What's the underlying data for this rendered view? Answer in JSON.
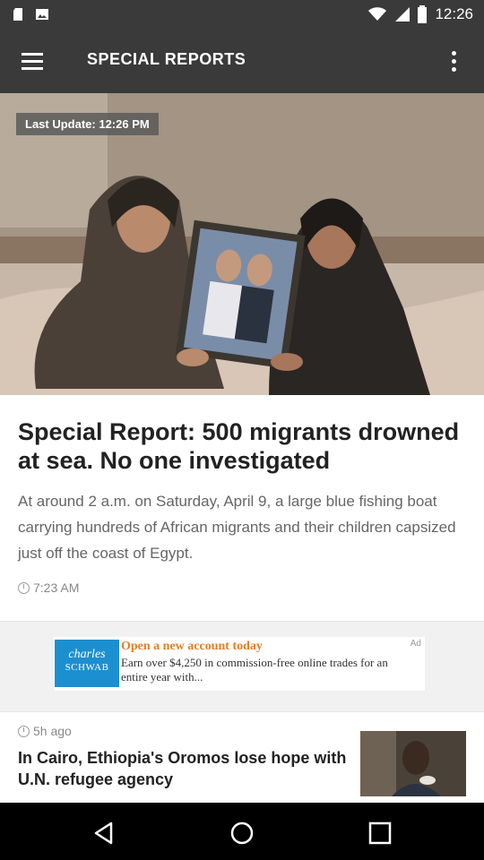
{
  "status_bar": {
    "time": "12:26",
    "icons": [
      "sd-card-icon",
      "image-icon",
      "wifi-icon",
      "signal-icon",
      "battery-icon"
    ]
  },
  "app_bar": {
    "title": "SPECIAL REPORTS",
    "menu_icon": "hamburger-menu-icon",
    "overflow_icon": "more-vertical-icon"
  },
  "featured": {
    "last_update": "Last Update: 12:26 PM",
    "headline": "Special Report: 500 migrants drowned at sea. No one investigated",
    "summary": "At around 2 a.m. on Saturday, April 9, a large blue fishing boat carrying hundreds of African migrants and their children capsized just off the coast of Egypt.",
    "time": "7:23 AM"
  },
  "ad": {
    "label": "Ad",
    "logo_line1": "charles",
    "logo_line2": "SCHWAB",
    "headline": "Open a new account today",
    "body": "Earn over $4,250 in commission-free online trades for an entire year with...",
    "brand_color": "#1c8fd1",
    "headline_color": "#e87d1e"
  },
  "story2": {
    "time": "5h ago",
    "title": "In Cairo, Ethiopia's Oromos lose hope with U.N. refugee agency"
  },
  "nav": {
    "back_icon": "back-triangle-icon",
    "home_icon": "home-circle-icon",
    "recents_icon": "recents-square-icon"
  }
}
